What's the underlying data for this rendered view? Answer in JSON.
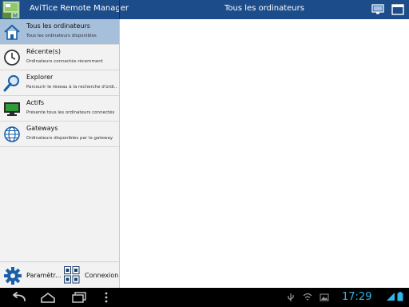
{
  "header": {
    "app_title": "AviTice Remote Manager",
    "page_title": "Tous les ordinateurs",
    "actions": [
      "monitor-screen-icon",
      "window-icon"
    ],
    "accent_color": "#1c4c8a"
  },
  "sidebar": {
    "items": [
      {
        "title": "Tous les ordinateurs",
        "subtitle": "Tous les ordinateurs disponibles",
        "icon": "home-icon",
        "selected": true
      },
      {
        "title": "Récente(s)",
        "subtitle": "Ordinateurs connectés récemment",
        "icon": "clock-icon",
        "selected": false
      },
      {
        "title": "Explorer",
        "subtitle": "Parcourir le réseau à la recherche d'ordi...",
        "icon": "magnifier-icon",
        "selected": false
      },
      {
        "title": "Actifs",
        "subtitle": "Présente tous les ordinateurs connectés",
        "icon": "monitor-icon",
        "selected": false
      },
      {
        "title": "Gateways",
        "subtitle": "Ordinateurs disponibles par la gateway",
        "icon": "globe-icon",
        "selected": false
      }
    ],
    "selected_color": "#a6bfdb",
    "footer": {
      "settings_label": "Paramètr...",
      "connect_label": "Connexion"
    }
  },
  "system_bar": {
    "time": "17:29",
    "clock_color": "#33b5e5"
  }
}
